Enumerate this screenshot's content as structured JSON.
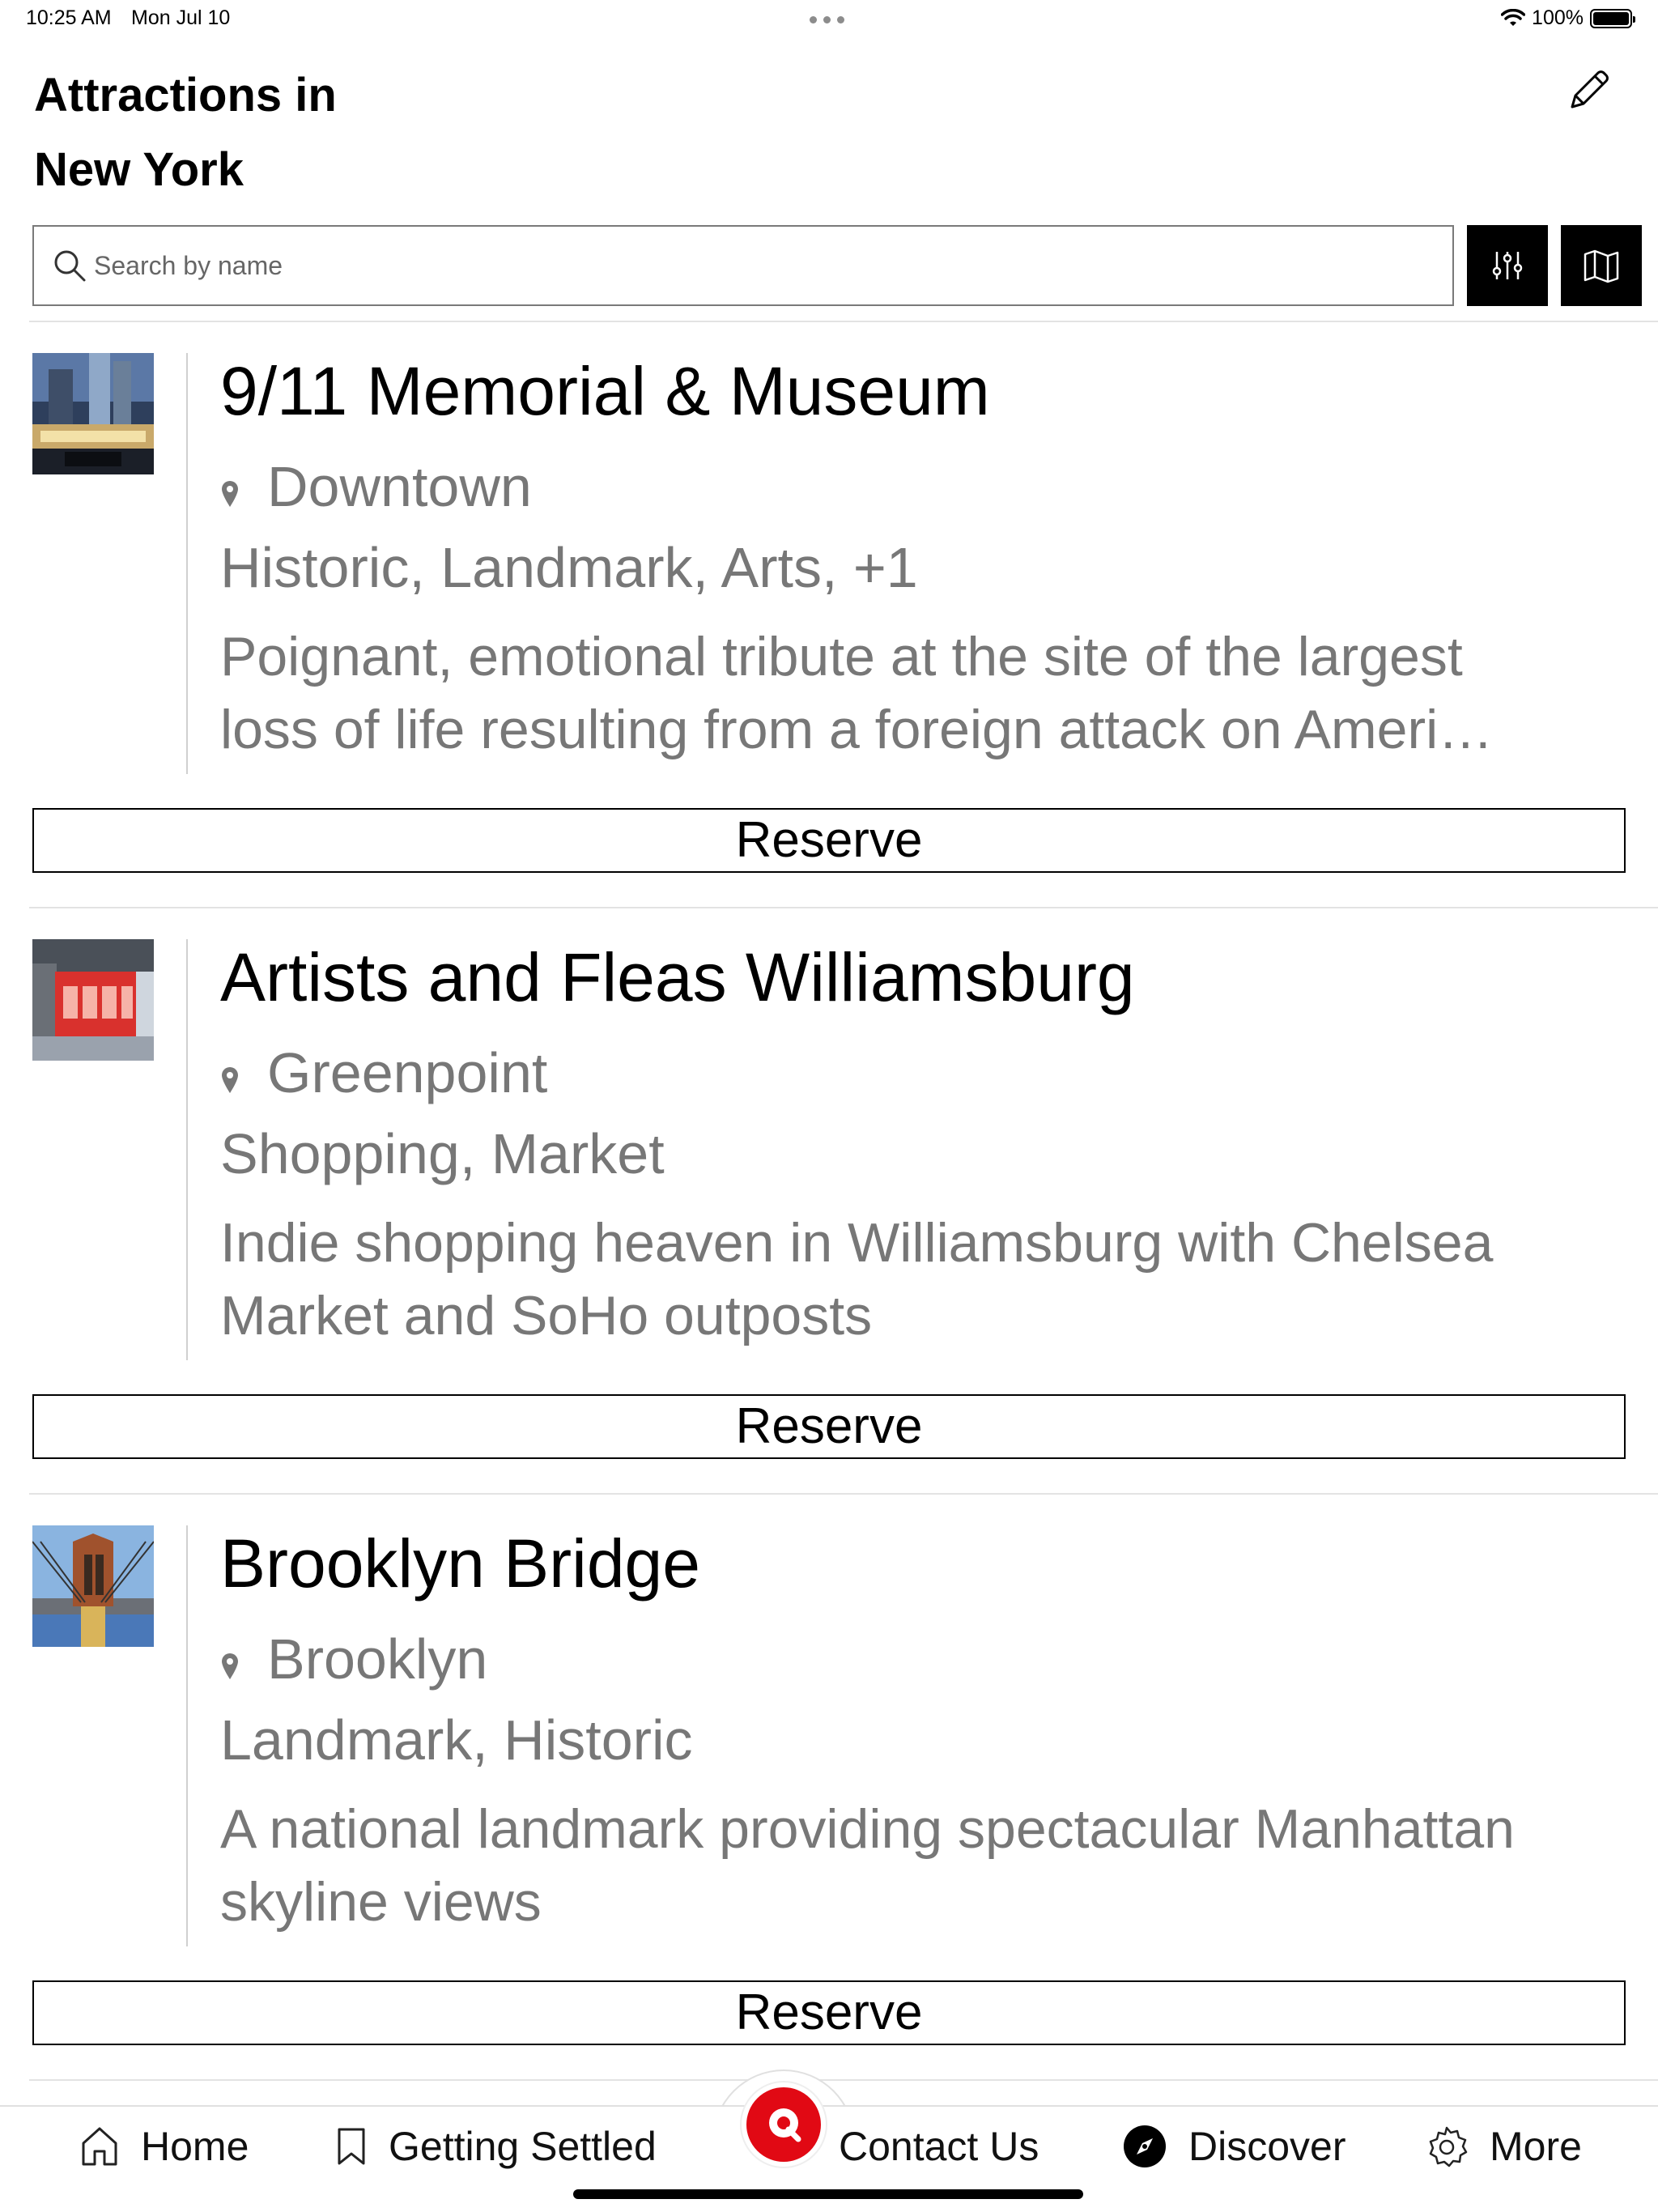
{
  "status_bar": {
    "time": "10:25 AM",
    "date": "Mon Jul 10",
    "battery": "100%"
  },
  "header": {
    "title": "Attractions in\nNew York",
    "title_line1": "Attractions in",
    "title_line2": "New York",
    "edit_icon": "pencil-icon"
  },
  "search": {
    "placeholder": "Search by name",
    "value": ""
  },
  "toolbar": {
    "filter_icon": "sliders-icon",
    "map_icon": "map-icon"
  },
  "attractions": [
    {
      "name": "9/11 Memorial & Museum",
      "location": "Downtown",
      "tags": "Historic, Landmark, Arts, +1",
      "description_line1": "Poignant, emotional tribute at the site of the largest",
      "description_line2": "loss of life resulting from a foreign attack on Ameri…",
      "reserve_label": "Reserve"
    },
    {
      "name": "Artists and Fleas Williamsburg",
      "location": "Greenpoint",
      "tags": "Shopping, Market",
      "description_line1": "Indie shopping heaven in Williamsburg with Chelsea",
      "description_line2": "Market and SoHo outposts",
      "reserve_label": "Reserve"
    },
    {
      "name": "Brooklyn Bridge",
      "location": "Brooklyn",
      "tags": "Landmark, Historic",
      "description_line1": "A national landmark providing spectacular Manhattan",
      "description_line2": "skyline views",
      "reserve_label": "Reserve"
    }
  ],
  "tab_bar": {
    "items": [
      {
        "label": "Home",
        "icon": "home-icon"
      },
      {
        "label": "Getting Settled",
        "icon": "bookmark-icon"
      },
      {
        "label": "Contact Us",
        "icon": "chat-icon"
      },
      {
        "label": "Discover",
        "icon": "compass-icon"
      },
      {
        "label": "More",
        "icon": "gear-icon"
      }
    ]
  },
  "colors": {
    "accent": "#e10914",
    "muted_text": "#777777",
    "button_bg": "#000000"
  }
}
